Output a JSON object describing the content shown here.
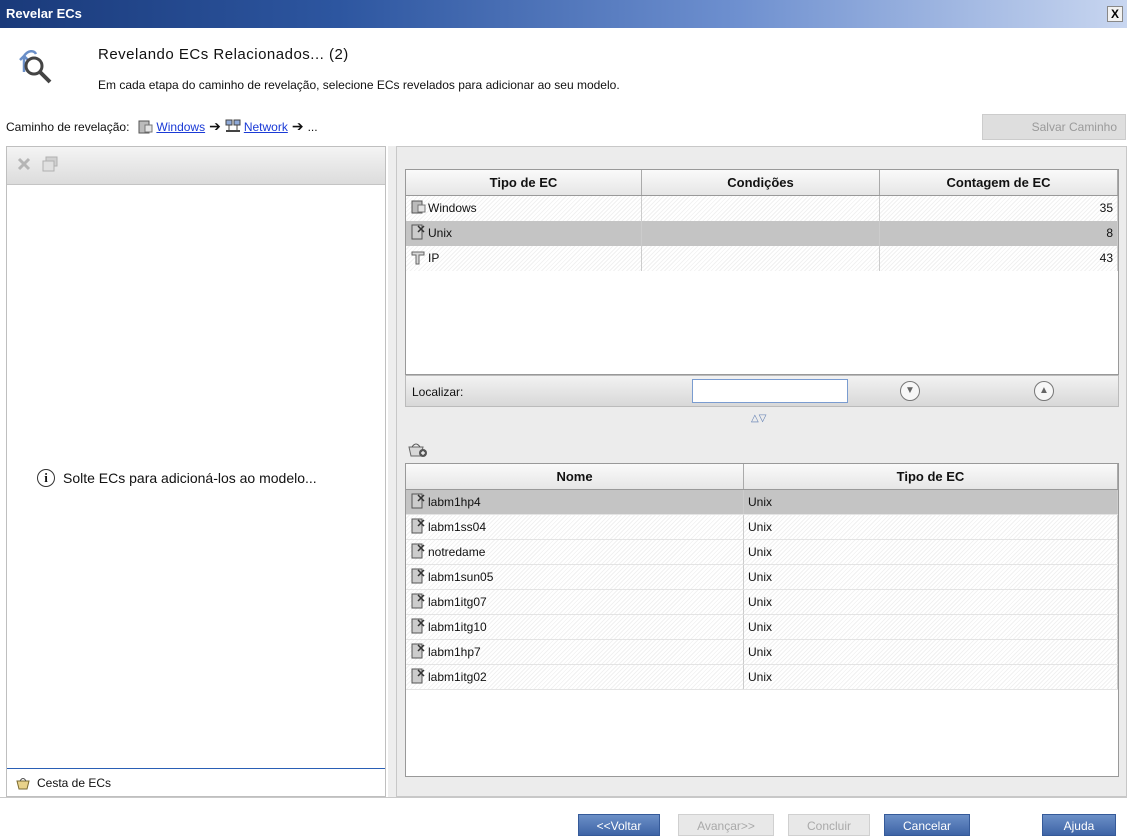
{
  "window": {
    "title": "Revelar ECs",
    "close_glyph": "X"
  },
  "header": {
    "title": "Revelando ECs Relacionados... (2)",
    "subtitle": "Em cada etapa do caminho de revelação, selecione ECs revelados para adicionar ao seu modelo.",
    "icon": "reveal-magnifier-icon"
  },
  "path": {
    "label": "Caminho de revelação:",
    "steps": [
      {
        "label": "Windows",
        "icon": "windows-server-icon"
      },
      {
        "label": "Network",
        "icon": "network-icon"
      }
    ],
    "ellipsis": "...",
    "save_label": "Salvar Caminho"
  },
  "left": {
    "toolbar": [
      "delete-icon",
      "copy-icon"
    ],
    "drop_hint": "Solte ECs para adicioná-los ao modelo...",
    "basket_label": "Cesta de ECs"
  },
  "ci_types_table": {
    "columns": [
      "Tipo de EC",
      "Condições",
      "Contagem de EC"
    ],
    "rows": [
      {
        "type": "Windows",
        "conditions": "",
        "count": "35",
        "selected": false,
        "icon": "windows-server-icon"
      },
      {
        "type": "Unix",
        "conditions": "",
        "count": "8",
        "selected": true,
        "icon": "unix-server-icon"
      },
      {
        "type": "IP",
        "conditions": "",
        "count": "43",
        "selected": false,
        "icon": "ip-icon"
      }
    ]
  },
  "find": {
    "label": "Localizar:",
    "value": "",
    "next_icon": "find-next-icon",
    "prev_icon": "find-previous-icon"
  },
  "cis_table": {
    "columns": [
      "Nome",
      "Tipo de EC"
    ],
    "rows": [
      {
        "name": "labm1hp4",
        "type": "Unix",
        "selected": true
      },
      {
        "name": "labm1ss04",
        "type": "Unix",
        "selected": false
      },
      {
        "name": "notredame",
        "type": "Unix",
        "selected": false
      },
      {
        "name": "labm1sun05",
        "type": "Unix",
        "selected": false
      },
      {
        "name": "labm1itg07",
        "type": "Unix",
        "selected": false
      },
      {
        "name": "labm1itg10",
        "type": "Unix",
        "selected": false
      },
      {
        "name": "labm1hp7",
        "type": "Unix",
        "selected": false
      },
      {
        "name": "labm1itg02",
        "type": "Unix",
        "selected": false
      }
    ]
  },
  "buttons": {
    "back": "<<Voltar",
    "next": "Avançar>>",
    "finish": "Concluir",
    "cancel": "Cancelar",
    "help": "Ajuda"
  }
}
